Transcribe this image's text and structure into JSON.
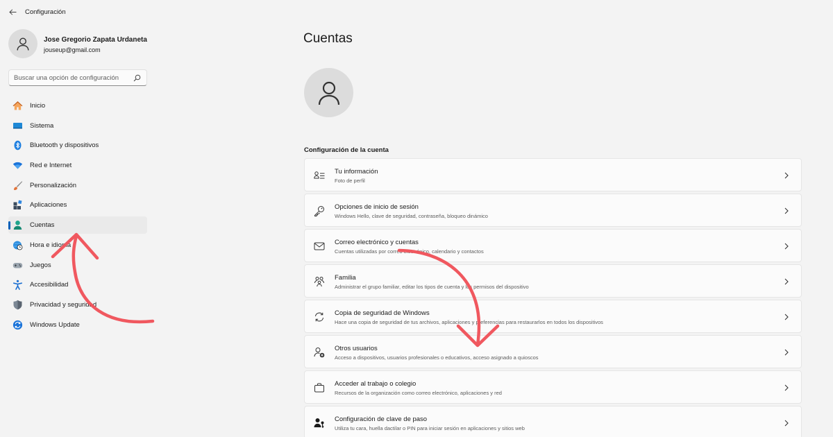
{
  "app": {
    "title": "Configuración"
  },
  "profile": {
    "name": "Jose Gregorio Zapata Urdaneta",
    "email": "jouseup@gmail.com"
  },
  "search": {
    "placeholder": "Buscar una opción de configuración"
  },
  "nav": {
    "items": [
      {
        "label": "Inicio",
        "icon": "home-icon"
      },
      {
        "label": "Sistema",
        "icon": "system-icon"
      },
      {
        "label": "Bluetooth y dispositivos",
        "icon": "bluetooth-icon"
      },
      {
        "label": "Red e Internet",
        "icon": "wifi-icon"
      },
      {
        "label": "Personalización",
        "icon": "brush-icon"
      },
      {
        "label": "Aplicaciones",
        "icon": "apps-icon"
      },
      {
        "label": "Cuentas",
        "icon": "account-icon",
        "active": true
      },
      {
        "label": "Hora e idioma",
        "icon": "globe-clock-icon"
      },
      {
        "label": "Juegos",
        "icon": "gamepad-icon"
      },
      {
        "label": "Accesibilidad",
        "icon": "accessibility-icon"
      },
      {
        "label": "Privacidad y seguridad",
        "icon": "shield-icon"
      },
      {
        "label": "Windows Update",
        "icon": "update-icon"
      }
    ]
  },
  "main": {
    "title": "Cuentas",
    "section_title": "Configuración de la cuenta",
    "cards": [
      {
        "title": "Tu información",
        "subtitle": "Foto de perfil",
        "icon": "person-info-icon"
      },
      {
        "title": "Opciones de inicio de sesión",
        "subtitle": "Windows Hello, clave de seguridad, contraseña, bloqueo dinámico",
        "icon": "key-icon"
      },
      {
        "title": "Correo electrónico y cuentas",
        "subtitle": "Cuentas utilizadas por correo electrónico, calendario y contactos",
        "icon": "mail-icon"
      },
      {
        "title": "Familia",
        "subtitle": "Administrar el grupo familiar, editar los tipos de cuenta y los permisos del dispositivo",
        "icon": "family-icon"
      },
      {
        "title": "Copia de seguridad de Windows",
        "subtitle": "Hace una copia de seguridad de tus archivos, aplicaciones y preferencias para restaurarlos en todos los dispositivos",
        "icon": "sync-icon"
      },
      {
        "title": "Otros usuarios",
        "subtitle": "Acceso a dispositivos, usuarios profesionales o educativos, acceso asignado a quioscos",
        "icon": "add-person-icon"
      },
      {
        "title": "Acceder al trabajo o colegio",
        "subtitle": "Recursos de la organización como correo electrónico, aplicaciones y red",
        "icon": "briefcase-icon"
      },
      {
        "title": "Configuración de clave de paso",
        "subtitle": "Utiliza tu cara, huella dactilar o PIN para iniciar sesión en aplicaciones y sitios web",
        "icon": "person-key-icon"
      }
    ]
  },
  "colors": {
    "accent": "#005fb8",
    "annotation_arrow": "#f0585f"
  }
}
